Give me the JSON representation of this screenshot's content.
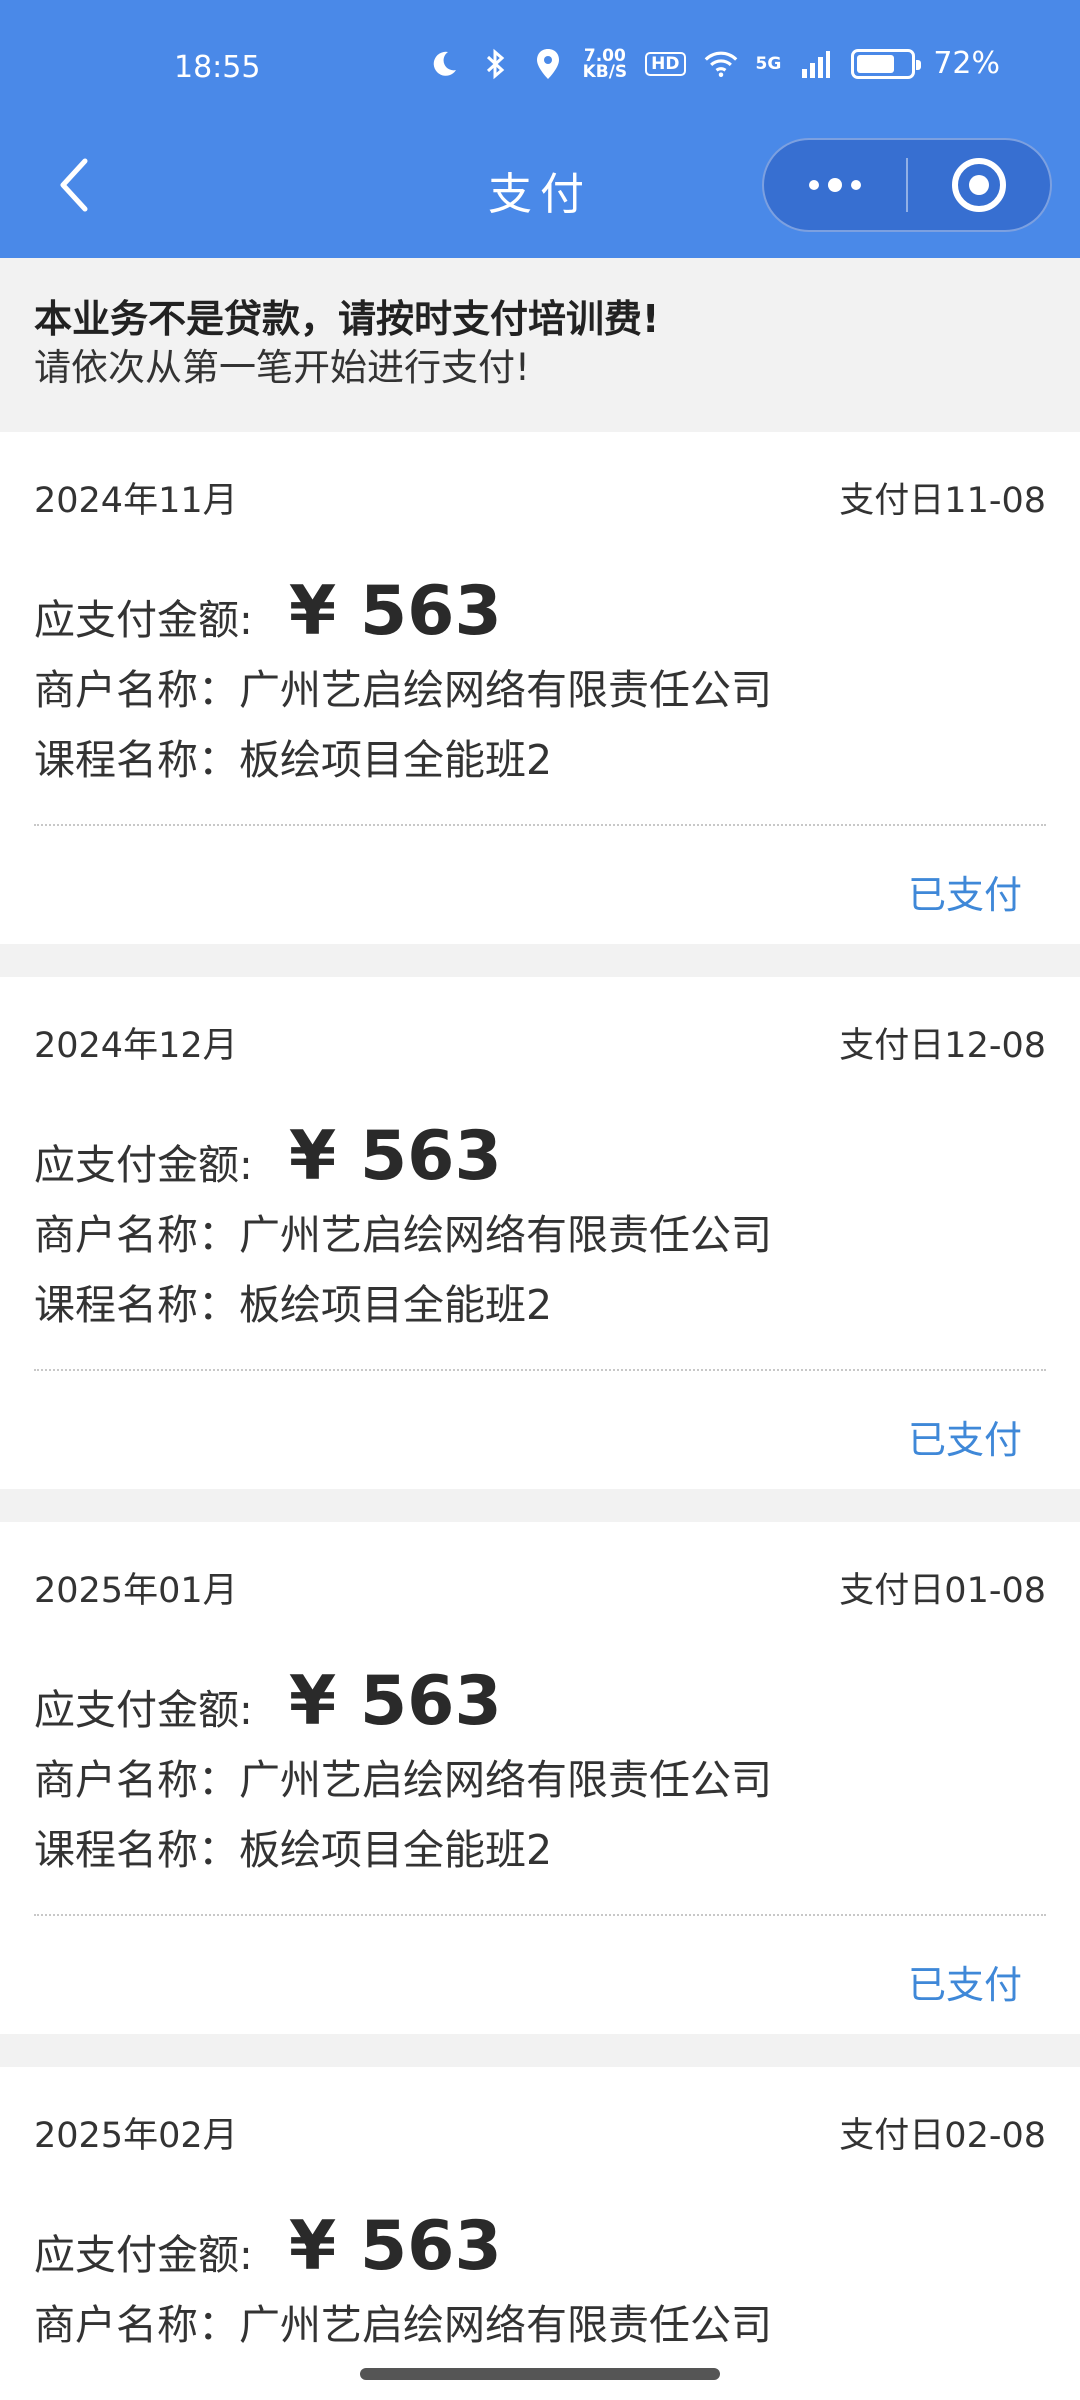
{
  "status_bar": {
    "time": "18:55",
    "speed_value": "7.00",
    "speed_unit": "KB/S",
    "hd_label": "HD",
    "network": "5G",
    "battery_percent": 72,
    "battery_text": "72%"
  },
  "nav": {
    "title": "支付"
  },
  "notice": {
    "title": "本业务不是贷款，请按时支付培训费!",
    "subtitle": "请依次从第一笔开始进行支付!"
  },
  "payments": [
    {
      "month": "2024年11月",
      "due": "支付日11-08",
      "amount_label": "应支付金额:",
      "amount": "¥ 563",
      "merchant": "商户名称：广州艺启绘网络有限责任公司",
      "course": "课程名称：板绘项目全能班2",
      "status": "已支付"
    },
    {
      "month": "2024年12月",
      "due": "支付日12-08",
      "amount_label": "应支付金额:",
      "amount": "¥ 563",
      "merchant": "商户名称：广州艺启绘网络有限责任公司",
      "course": "课程名称：板绘项目全能班2",
      "status": "已支付"
    },
    {
      "month": "2025年01月",
      "due": "支付日01-08",
      "amount_label": "应支付金额:",
      "amount": "¥ 563",
      "merchant": "商户名称：广州艺启绘网络有限责任公司",
      "course": "课程名称：板绘项目全能班2",
      "status": "已支付"
    },
    {
      "month": "2025年02月",
      "due": "支付日02-08",
      "amount_label": "应支付金额:",
      "amount": "¥ 563",
      "merchant": "商户名称：广州艺启绘网络有限责任公司"
    }
  ]
}
